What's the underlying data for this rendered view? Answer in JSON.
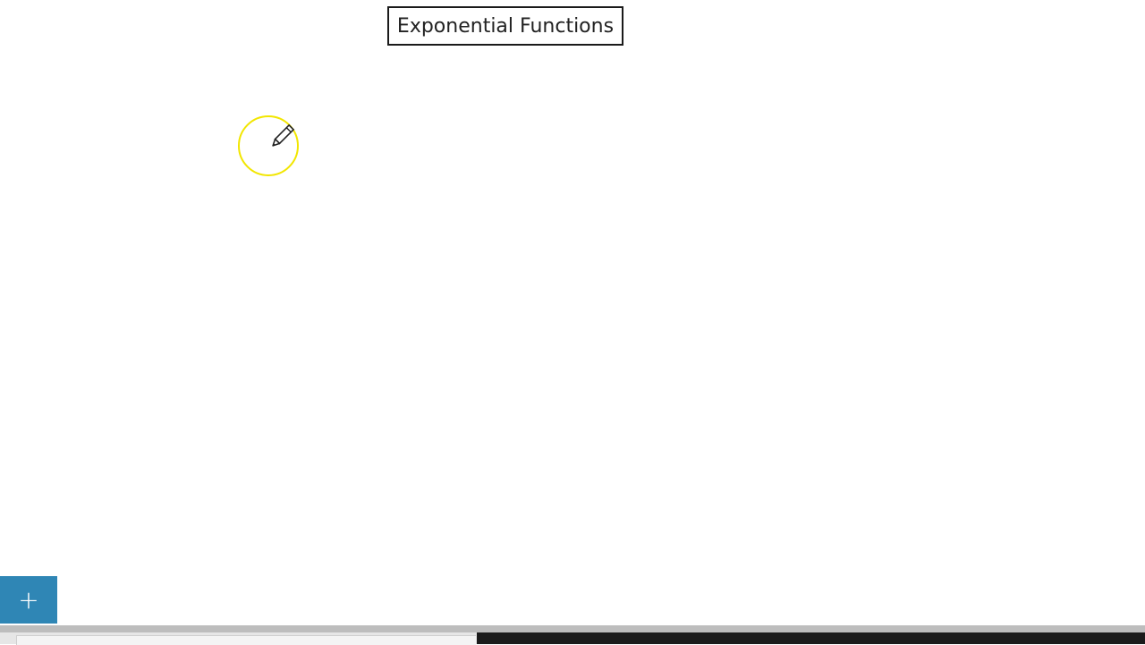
{
  "canvas": {
    "title": "Exponential Functions"
  },
  "cursor": {
    "icon": "pencil-icon",
    "highlight_color": "#f2e600"
  },
  "add_button": {
    "label": "+",
    "color": "#2f86b5"
  }
}
